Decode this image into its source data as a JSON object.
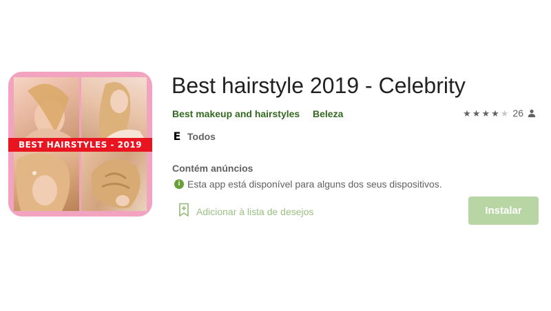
{
  "app": {
    "title": "Best hairstyle 2019 - Celebrity",
    "developer": "Best makeup and hairstyles",
    "category": "Beleza",
    "icon_banner_text": "BEST HAIRSTYLES - 2019",
    "rating": {
      "stars_value": 4,
      "stars_max": 5,
      "count": "26"
    },
    "content_rating": {
      "badge": "E",
      "label": "Todos"
    },
    "ads_label": "Contém anúncios",
    "availability_text": "Esta app está disponível para alguns dos seus dispositivos."
  },
  "actions": {
    "wishlist_label": "Adicionar à lista de desejos",
    "install_label": "Instalar"
  },
  "colors": {
    "accent_green": "#33691e",
    "install_button_bg": "#b8d5a4",
    "icon_frame": "#f2a3bf",
    "banner_red": "#e8141f",
    "info_green": "#689f38"
  },
  "icons": {
    "star": "star-icon",
    "person": "person-icon",
    "info": "info-icon",
    "bookmark": "bookmark-add-icon",
    "esrb": "esrb-everyone-icon"
  }
}
